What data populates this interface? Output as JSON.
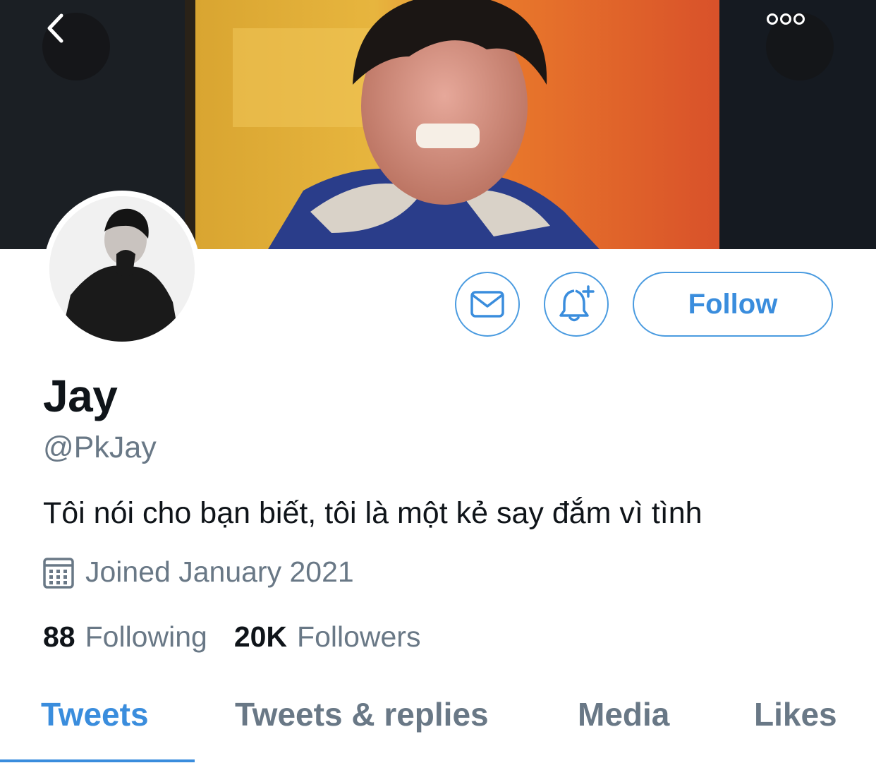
{
  "header": {
    "back_icon": "chevron-left-icon",
    "more_icon": "ellipsis-icon"
  },
  "profile": {
    "name": "Jay",
    "handle": "@PkJay",
    "bio": "Tôi nói cho bạn biết, tôi là một kẻ say đắm vì tình",
    "joined": "Joined January 2021",
    "following_count": "88",
    "following_label": "Following",
    "followers_count": "20K",
    "followers_label": "Followers"
  },
  "actions": {
    "message_icon": "envelope-icon",
    "notify_icon": "bell-plus-icon",
    "follow_label": "Follow"
  },
  "tabs": [
    {
      "label": "Tweets",
      "active": true
    },
    {
      "label": "Tweets & replies",
      "active": false
    },
    {
      "label": "Media",
      "active": false
    },
    {
      "label": "Likes",
      "active": false
    }
  ],
  "colors": {
    "accent": "#3a8ddd",
    "secondary_text": "#697886",
    "primary_text": "#0f1419"
  }
}
